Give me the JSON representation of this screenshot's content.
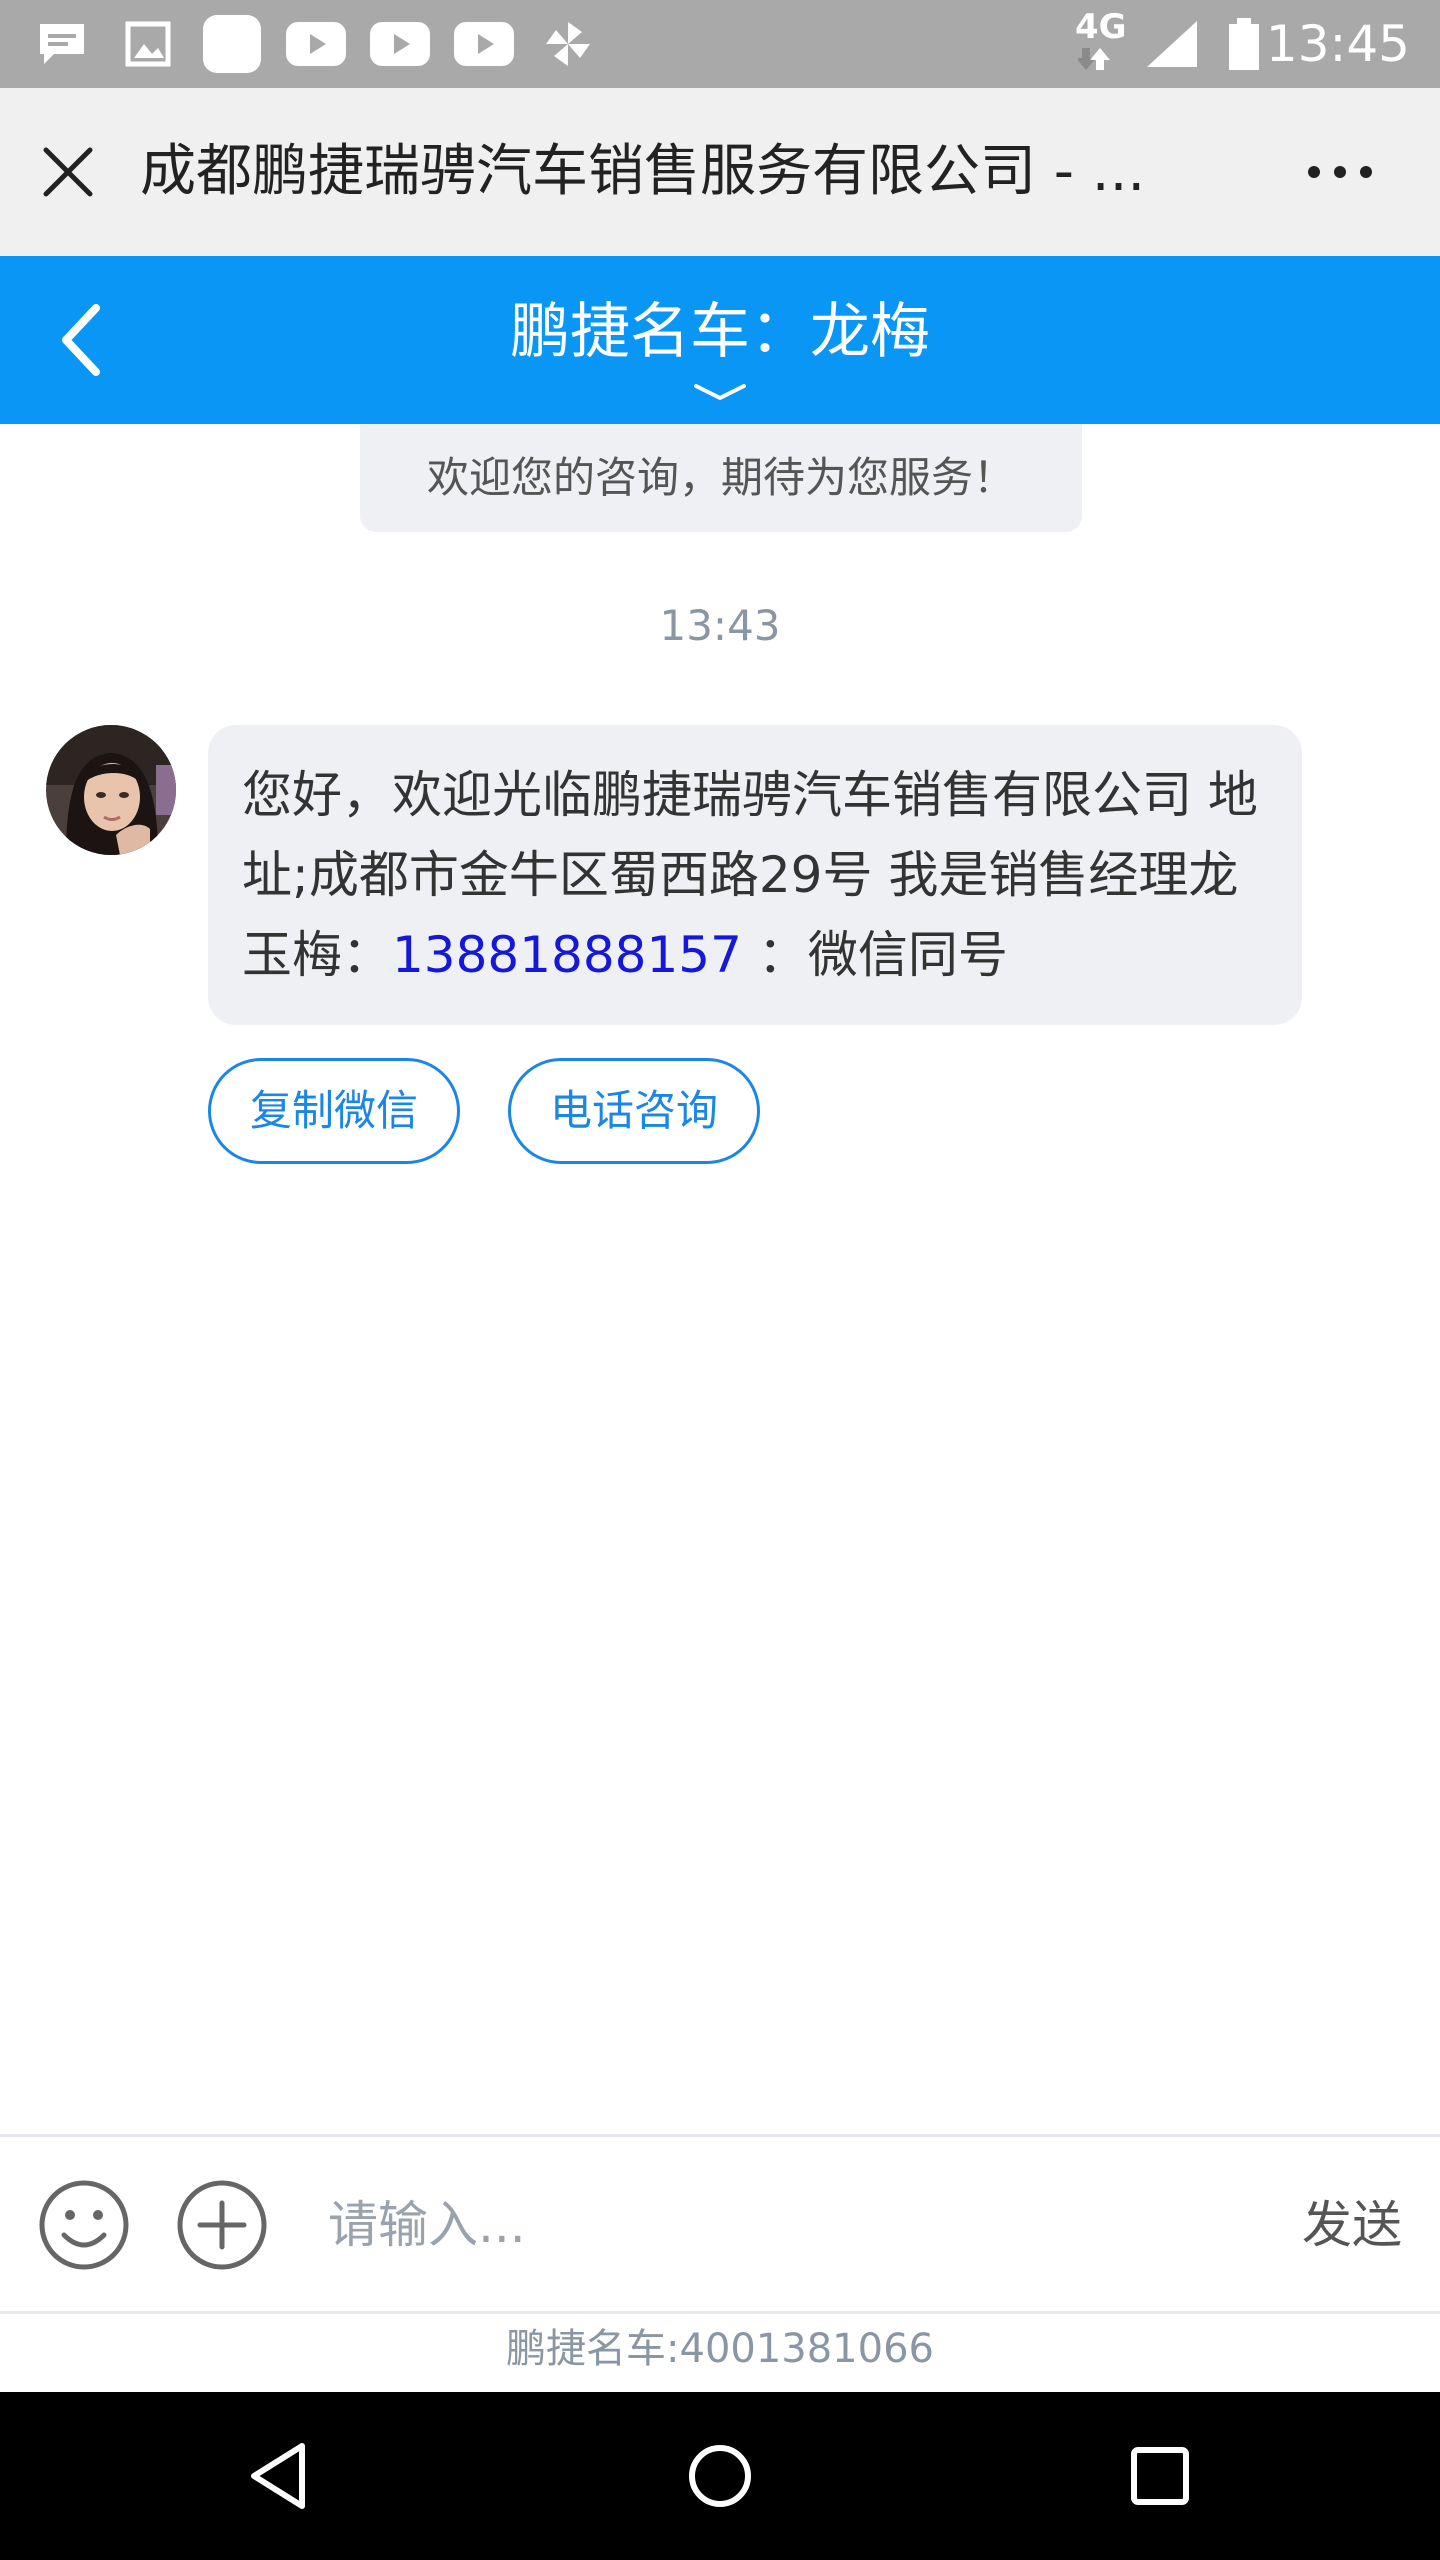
{
  "status_bar": {
    "time": "13:45",
    "network": "4G",
    "notification_icons": [
      "message-icon",
      "image-icon",
      "app-icon",
      "youtube-icon",
      "youtube-icon",
      "youtube-icon",
      "pinwheel-icon"
    ]
  },
  "browser": {
    "title": "成都鹏捷瑞骋汽车销售服务有限公司 - ..."
  },
  "chat": {
    "title": "鹏捷名车：龙梅",
    "welcome": "欢迎您的咨询，期待为您服务！",
    "timestamp": "13:43",
    "message": {
      "text_before": "您好，欢迎光临鹏捷瑞骋汽车销售有限公司  地址;成都市金牛区蜀西路29号   我是销售经理龙玉梅：",
      "phone": "13881888157",
      "text_after": " ：微信同号"
    },
    "actions": {
      "copy_wechat": "复制微信",
      "phone_consult": "电话咨询"
    }
  },
  "input": {
    "placeholder": "请输入...",
    "send_label": "发送"
  },
  "footer": {
    "hotline": "鹏捷名车:4001381066"
  },
  "colors": {
    "header_blue": "#0a96f5",
    "action_blue": "#1a86e8",
    "phone_link": "#1518d6"
  }
}
